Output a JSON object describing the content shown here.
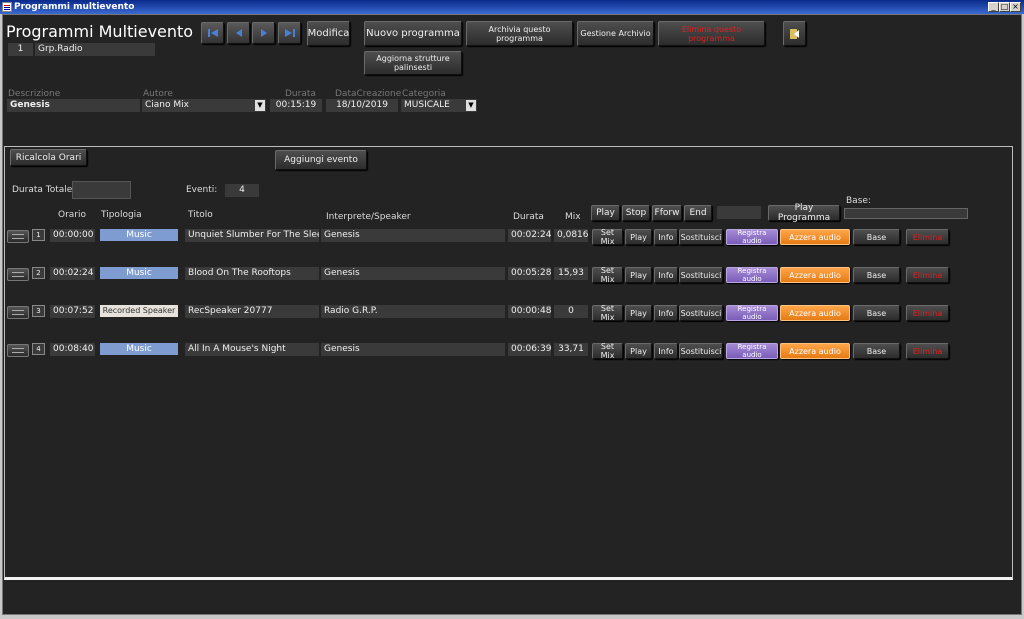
{
  "window": {
    "title": "Programmi multievento"
  },
  "header": {
    "page_title": "Programmi Multievento",
    "group_id": "1",
    "group_name": "Grp.Radio",
    "modifica_label": "Modifica",
    "nuovo_programma": "Nuovo programma",
    "archivia": "Archivia questo programma",
    "gestione_archivio": "Gestione Archivio",
    "elimina_programma": "Elimina questo programma",
    "aggiorna": "Aggiorna strutture palinsesti"
  },
  "form": {
    "descrizione_label": "Descrizione",
    "descrizione": "Genesis",
    "autore_label": "Autore",
    "autore": "Ciano Mix",
    "durata_label": "Durata",
    "durata": "00:15:19",
    "datacreazione_label": "DataCreazione",
    "datacreazione": "18/10/2019",
    "categoria_label": "Categoria",
    "categoria": "MUSICALE"
  },
  "panel": {
    "ricalcola": "Ricalcola Orari",
    "aggiungi": "Aggiungi evento",
    "durata_totale_label": "Durata Totale",
    "durata_totale": "",
    "eventi_label": "Eventi:",
    "eventi": "4",
    "player": {
      "play": "Play",
      "stop": "Stop",
      "fforw": "Fforw",
      "end": "End",
      "play_programma": "Play Programma",
      "base_label": "Base:"
    },
    "columns": {
      "orario": "Orario",
      "tipologia": "Tipologia",
      "titolo": "Titolo",
      "interprete": "Interprete/Speaker",
      "durata": "Durata",
      "mix": "Mix"
    },
    "row_buttons": {
      "set_mix": "Set Mix",
      "play": "Play",
      "info": "Info",
      "sostituisci": "Sostituisci",
      "registra": "Registra audio",
      "azzera": "Azzera audio",
      "base": "Base",
      "elimina": "Elimina"
    },
    "rows": [
      {
        "n": "1",
        "orario": "00:00:00",
        "tipologia": "Music",
        "titolo": "Unquiet Slumber For The Sleepers",
        "interprete": "Genesis",
        "durata": "00:02:24",
        "mix": "0,0816"
      },
      {
        "n": "2",
        "orario": "00:02:24",
        "tipologia": "Music",
        "titolo": "Blood On The Rooftops",
        "interprete": "Genesis",
        "durata": "00:05:28",
        "mix": "15,93"
      },
      {
        "n": "3",
        "orario": "00:07:52",
        "tipologia": "Recorded Speaker",
        "titolo": "RecSpeaker 20777",
        "interprete": "Radio G.R.P.",
        "durata": "00:00:48",
        "mix": "0"
      },
      {
        "n": "4",
        "orario": "00:08:40",
        "tipologia": "Music",
        "titolo": "All In A Mouse's Night",
        "interprete": "Genesis",
        "durata": "00:06:39",
        "mix": "33,71"
      }
    ]
  }
}
